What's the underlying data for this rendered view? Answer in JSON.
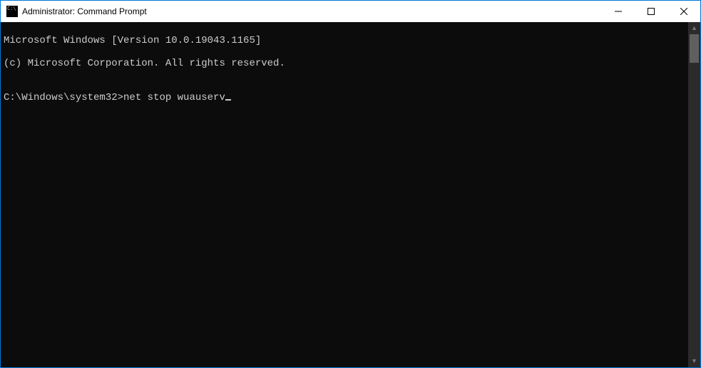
{
  "window": {
    "title": "Administrator: Command Prompt"
  },
  "terminal": {
    "lines": [
      "Microsoft Windows [Version 10.0.19043.1165]",
      "(c) Microsoft Corporation. All rights reserved.",
      ""
    ],
    "prompt": "C:\\Windows\\system32>",
    "command": "net stop wuauserv"
  }
}
